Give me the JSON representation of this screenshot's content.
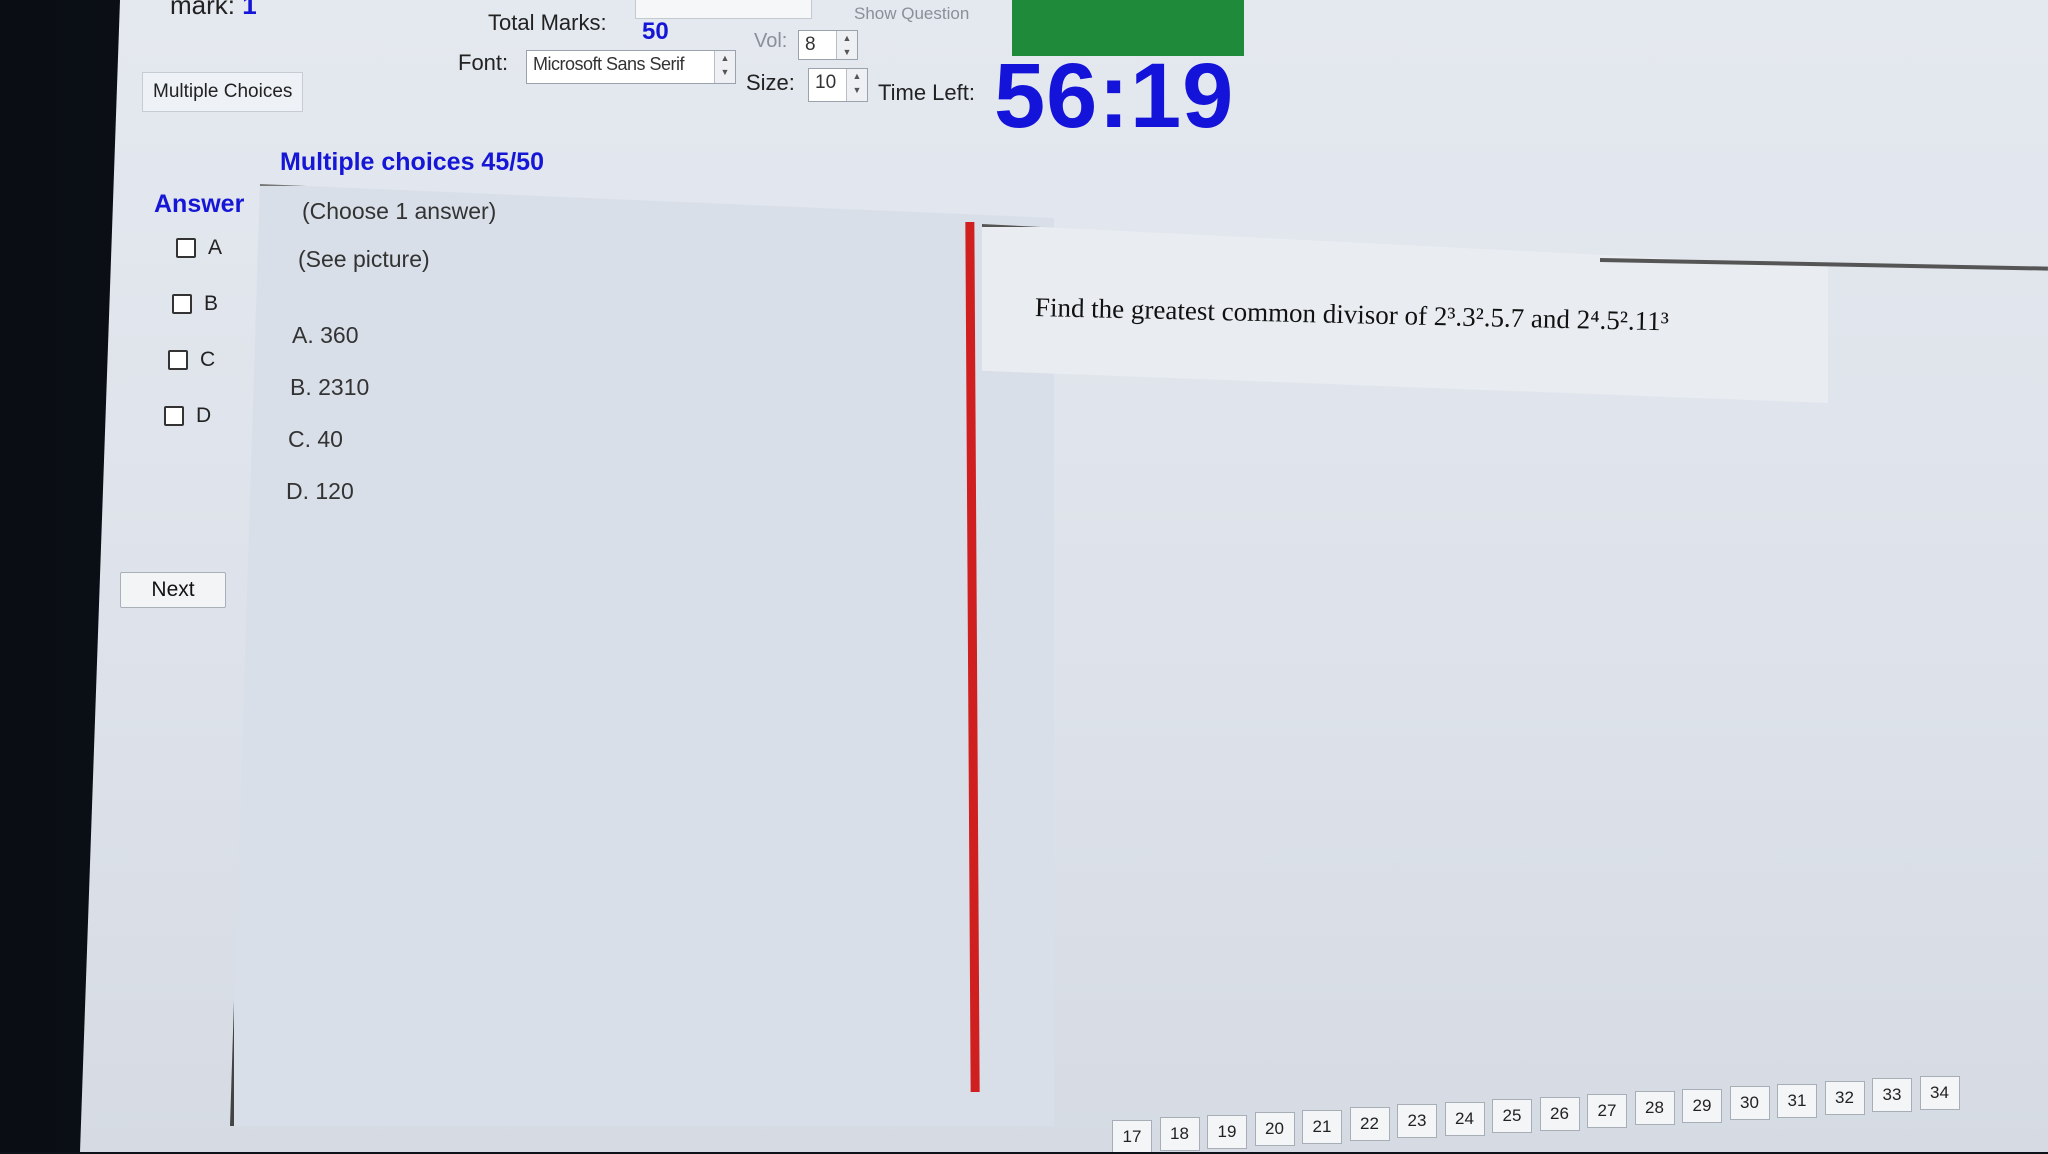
{
  "header": {
    "mark_label": "mark:",
    "mark_value": "1",
    "total_marks_label": "Total Marks:",
    "total_marks_value": "50",
    "show_question_label": "Show Question",
    "vol_label": "Vol:",
    "vol_value": "8",
    "font_label": "Font:",
    "font_value": "Microsoft Sans Serif",
    "size_label": "Size:",
    "size_value": "10",
    "time_left_label": "Time Left:",
    "time_left_value": "56:19",
    "status_color": "#1e8a3a"
  },
  "tabs": [
    {
      "label": "Multiple Choices"
    }
  ],
  "section": {
    "title": "Multiple choices 45/50"
  },
  "answer": {
    "heading": "Answer",
    "options": [
      {
        "label": "A"
      },
      {
        "label": "B"
      },
      {
        "label": "C"
      },
      {
        "label": "D"
      }
    ],
    "next_label": "Next"
  },
  "question_panel": {
    "instruction": "(Choose 1 answer)",
    "note": "(See picture)",
    "choices": [
      {
        "text": "A.  360"
      },
      {
        "text": "B.  2310"
      },
      {
        "text": "C.  40"
      },
      {
        "text": "D.  120"
      }
    ]
  },
  "picture_panel": {
    "question_text": "Find the greatest common divisor of 2³.3².5.7 and 2⁴.5².11³"
  },
  "pagination": [
    "17",
    "18",
    "19",
    "20",
    "21",
    "22",
    "23",
    "24",
    "25",
    "26",
    "27",
    "28",
    "29",
    "30",
    "31",
    "32",
    "33",
    "34"
  ],
  "colors": {
    "accent": "#1616d6",
    "divider": "#cf1f1f"
  }
}
